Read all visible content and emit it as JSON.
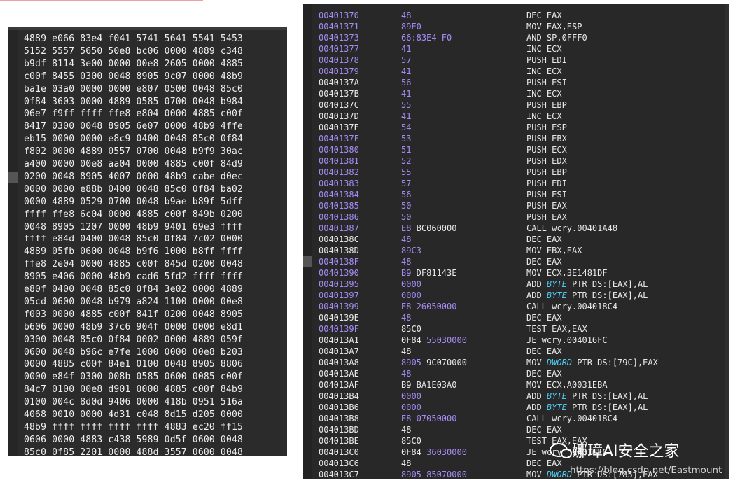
{
  "hex_dump": {
    "lines": [
      "4889 e066 83e4 f041 5741 5641 5541 5453",
      "5152 5557 5650 50e8 bc06 0000 4889 c348",
      "b9df 8114 3e00 0000 00e8 2605 0000 4885",
      "c00f 8455 0300 0048 8905 9c07 0000 48b9",
      "ba1e 03a0 0000 0000 e807 0500 0048 85c0",
      "0f84 3603 0000 4889 0585 0700 0048 b984",
      "06e7 f9ff ffff ffe8 e804 0000 4885 c00f",
      "8417 0300 0048 8905 6e07 0000 48b9 4ffe",
      "eb15 0000 0000 e8c9 0400 0048 85c0 0f84",
      "f802 0000 4889 0557 0700 0048 b9f9 30ac",
      "a400 0000 00e8 aa04 0000 4885 c00f 84d9",
      "0200 0048 8905 4007 0000 48b9 cabe d0ec",
      "0000 0000 e88b 0400 0048 85c0 0f84 ba02",
      "0000 4889 0529 0700 0048 b9ae b89f 5dff",
      "ffff ffe8 6c04 0000 4885 c00f 849b 0200",
      "0048 8905 1207 0000 48b9 9401 69e3 ffff",
      "ffff e84d 0400 0048 85c0 0f84 7c02 0000",
      "4889 05fb 0600 0048 b9f6 1000 b8ff ffff",
      "ffe8 2e04 0000 4885 c00f 845d 0200 0048",
      "8905 e406 0000 48b9 cad6 5fd2 ffff ffff",
      "e80f 0400 0048 85c0 0f84 3e02 0000 4889",
      "05cd 0600 0048 b979 a824 1100 0000 00e8",
      "f003 0000 4885 c00f 841f 0200 0048 8905",
      "b606 0000 48b9 37c6 904f 0000 0000 e8d1",
      "0300 0048 85c0 0f84 0002 0000 4889 059f",
      "0600 0048 b96c e7fe 1000 0000 00e8 b203",
      "0000 4885 c00f 84e1 0100 0048 8905 8806",
      "0000 e84f 0300 008b 0585 0600 0085 c00f",
      "84c7 0100 00e8 d901 0000 4885 c00f 84b9",
      "0100 004c 8d0d 9406 0000 418b 0951 516a",
      "4068 0010 0000 4d31 c048 8d15 d205 0000",
      "48b9 ffff ffff ffff ffff 4883 ec20 ff15",
      "0606 0000 4883 c438 5989 0d5f 0600 0048",
      "85c0 0f85 2201 0000 488d 3557 0600 0048"
    ]
  },
  "disassembly": {
    "rows": [
      {
        "addr": "00401370",
        "ac": "p",
        "b1": "48",
        "b2": "",
        "parts": [
          {
            "t": "DEC EAX"
          }
        ]
      },
      {
        "addr": "00401371",
        "ac": "p",
        "b1": "89E0",
        "b2": "",
        "parts": [
          {
            "t": "MOV EAX,ESP"
          }
        ]
      },
      {
        "addr": "00401373",
        "ac": "p",
        "b1": "66:83E4 F0",
        "b2": "",
        "parts": [
          {
            "t": "AND SP,0FFF0"
          }
        ]
      },
      {
        "addr": "00401377",
        "ac": "p",
        "b1": "41",
        "b2": "",
        "parts": [
          {
            "t": "INC ECX"
          }
        ]
      },
      {
        "addr": "00401378",
        "ac": "p",
        "b1": "57",
        "b2": "",
        "parts": [
          {
            "t": "PUSH EDI"
          }
        ]
      },
      {
        "addr": "00401379",
        "ac": "p",
        "b1": "41",
        "b2": "",
        "parts": [
          {
            "t": "INC ECX"
          }
        ]
      },
      {
        "addr": "0040137A",
        "ac": "w",
        "b1": "56",
        "b2": "",
        "parts": [
          {
            "t": "PUSH ESI"
          }
        ]
      },
      {
        "addr": "0040137B",
        "ac": "w",
        "b1": "41",
        "b2": "",
        "parts": [
          {
            "t": "INC ECX"
          }
        ]
      },
      {
        "addr": "0040137C",
        "ac": "w",
        "b1": "55",
        "b2": "",
        "parts": [
          {
            "t": "PUSH EBP"
          }
        ]
      },
      {
        "addr": "0040137D",
        "ac": "w",
        "b1": "41",
        "b2": "",
        "parts": [
          {
            "t": "INC ECX"
          }
        ]
      },
      {
        "addr": "0040137E",
        "ac": "w",
        "b1": "54",
        "b2": "",
        "parts": [
          {
            "t": "PUSH ESP"
          }
        ]
      },
      {
        "addr": "0040137F",
        "ac": "p",
        "b1": "53",
        "b2": "",
        "parts": [
          {
            "t": "PUSH EBX"
          }
        ]
      },
      {
        "addr": "00401380",
        "ac": "p",
        "b1": "51",
        "b2": "",
        "parts": [
          {
            "t": "PUSH ECX"
          }
        ]
      },
      {
        "addr": "00401381",
        "ac": "p",
        "b1": "52",
        "b2": "",
        "parts": [
          {
            "t": "PUSH EDX"
          }
        ]
      },
      {
        "addr": "00401382",
        "ac": "p",
        "b1": "55",
        "b2": "",
        "parts": [
          {
            "t": "PUSH EBP"
          }
        ]
      },
      {
        "addr": "00401383",
        "ac": "p",
        "b1": "57",
        "b2": "",
        "parts": [
          {
            "t": "PUSH EDI"
          }
        ]
      },
      {
        "addr": "00401384",
        "ac": "p",
        "b1": "56",
        "b2": "",
        "parts": [
          {
            "t": "PUSH ESI"
          }
        ]
      },
      {
        "addr": "00401385",
        "ac": "p",
        "b1": "50",
        "b2": "",
        "parts": [
          {
            "t": "PUSH EAX"
          }
        ]
      },
      {
        "addr": "00401386",
        "ac": "p",
        "b1": "50",
        "b2": "",
        "parts": [
          {
            "t": "PUSH EAX"
          }
        ]
      },
      {
        "addr": "00401387",
        "ac": "p",
        "b1": "E8",
        "b2": " BC060000",
        "b2c": "w",
        "parts": [
          {
            "t": "CALL wcry.00401A48"
          }
        ]
      },
      {
        "addr": "0040138C",
        "ac": "w",
        "b1": "48",
        "b2": "",
        "parts": [
          {
            "t": "DEC EAX"
          }
        ]
      },
      {
        "addr": "0040138D",
        "ac": "w",
        "b1": "89C3",
        "b2": "",
        "parts": [
          {
            "t": "MOV EBX,EAX"
          }
        ]
      },
      {
        "addr": "0040138F",
        "ac": "p",
        "b1": "48",
        "b2": "",
        "parts": [
          {
            "t": "DEC EAX"
          }
        ]
      },
      {
        "addr": "00401390",
        "ac": "p",
        "b1": "B9",
        "b2": " DF81143E",
        "b2c": "w",
        "parts": [
          {
            "t": "MOV ECX,3E1481DF"
          }
        ]
      },
      {
        "addr": "00401395",
        "ac": "p",
        "b1": "0000",
        "b2": "",
        "parts": [
          {
            "t": "ADD "
          },
          {
            "t": "BYTE",
            "k": true
          },
          {
            "t": " PTR DS:[EAX],AL"
          }
        ]
      },
      {
        "addr": "00401397",
        "ac": "p",
        "b1": "0000",
        "b2": "",
        "parts": [
          {
            "t": "ADD "
          },
          {
            "t": "BYTE",
            "k": true
          },
          {
            "t": " PTR DS:[EAX],AL"
          }
        ]
      },
      {
        "addr": "00401399",
        "ac": "p",
        "b1": "E8",
        "b2": " 26050000",
        "b2c": "p",
        "parts": [
          {
            "t": "CALL wcry.004018C4"
          }
        ]
      },
      {
        "addr": "0040139E",
        "ac": "w",
        "b1": "48",
        "b2": "",
        "parts": [
          {
            "t": "DEC EAX"
          }
        ]
      },
      {
        "addr": "0040139F",
        "ac": "p",
        "b1": "85C0",
        "b2": "",
        "b1c": "w",
        "parts": [
          {
            "t": "TEST EAX,EAX"
          }
        ]
      },
      {
        "addr": "004013A1",
        "ac": "w",
        "b1": "0F84",
        "b2": " 55030000",
        "b1c": "w",
        "b2c": "p",
        "parts": [
          {
            "t": "JE wcry.004016FC"
          }
        ]
      },
      {
        "addr": "004013A7",
        "ac": "w",
        "b1": "48",
        "b2": "",
        "b1c": "w",
        "parts": [
          {
            "t": "DEC EAX"
          }
        ]
      },
      {
        "addr": "004013A8",
        "ac": "w",
        "b1": "8905",
        "b2": " 9C070000",
        "b2c": "w",
        "parts": [
          {
            "t": "MOV "
          },
          {
            "t": "DWORD",
            "k": true
          },
          {
            "t": " PTR DS:[79C],EAX"
          }
        ]
      },
      {
        "addr": "004013AE",
        "ac": "w",
        "b1": "48",
        "b2": "",
        "parts": [
          {
            "t": "DEC EAX"
          }
        ]
      },
      {
        "addr": "004013AF",
        "ac": "w",
        "b1": "B9",
        "b2": " BA1E03A0",
        "b1c": "w",
        "b2c": "w",
        "parts": [
          {
            "t": "MOV ECX,A0031EBA"
          }
        ]
      },
      {
        "addr": "004013B4",
        "ac": "w",
        "b1": "0000",
        "b2": "",
        "parts": [
          {
            "t": "ADD "
          },
          {
            "t": "BYTE",
            "k": true
          },
          {
            "t": " PTR DS:[EAX],AL"
          }
        ]
      },
      {
        "addr": "004013B6",
        "ac": "w",
        "b1": "0000",
        "b2": "",
        "parts": [
          {
            "t": "ADD "
          },
          {
            "t": "BYTE",
            "k": true
          },
          {
            "t": " PTR DS:[EAX],AL"
          }
        ]
      },
      {
        "addr": "004013B8",
        "ac": "w",
        "b1": "E8",
        "b2": " 07050000",
        "b2c": "p",
        "parts": [
          {
            "t": "CALL wcry.004018C4"
          }
        ]
      },
      {
        "addr": "004013BD",
        "ac": "w",
        "b1": "48",
        "b2": "",
        "b1c": "w",
        "parts": [
          {
            "t": "DEC EAX"
          }
        ]
      },
      {
        "addr": "004013BE",
        "ac": "w",
        "b1": "85C0",
        "b2": "",
        "b1c": "w",
        "parts": [
          {
            "t": "TEST EAX,EAX"
          }
        ]
      },
      {
        "addr": "004013C0",
        "ac": "w",
        "b1": "0F84",
        "b2": " 36030000",
        "b1c": "w",
        "b2c": "p",
        "parts": [
          {
            "t": "JE wcry.004016FC"
          }
        ]
      },
      {
        "addr": "004013C6",
        "ac": "w",
        "b1": "48",
        "b2": "",
        "b1c": "w",
        "parts": [
          {
            "t": "DEC EAX"
          }
        ]
      },
      {
        "addr": "004013C7",
        "ac": "w",
        "b1": "8905",
        "b2": " 85070000",
        "b2c": "p",
        "parts": [
          {
            "t": "MOV "
          },
          {
            "t": "DWORD",
            "k": true
          },
          {
            "t": " PTR DS:[785],EAX"
          }
        ]
      }
    ]
  },
  "watermark": {
    "icon": "wechat-icon",
    "text": "娜璋AI安全之家",
    "url": "https://blog.csdn.net/Eastmount"
  },
  "colors": {
    "purple": "#a58cf5",
    "keyword": "#4fc9ef",
    "panel_bg": "#2b2b2b"
  }
}
